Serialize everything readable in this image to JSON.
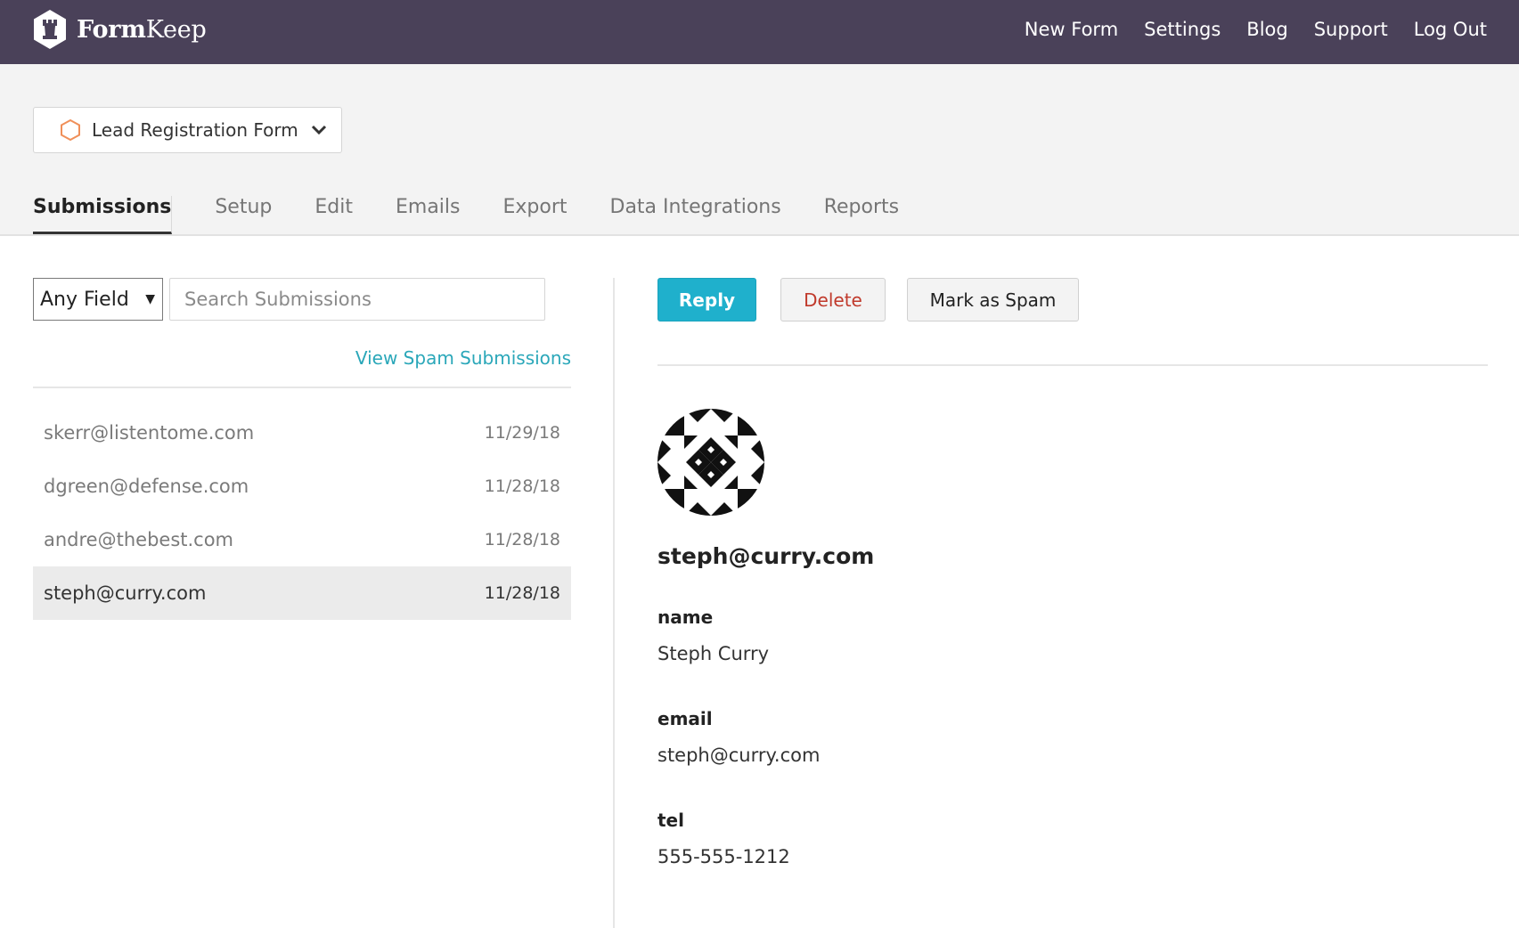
{
  "app": {
    "brand_bold": "Form",
    "brand_light": "Keep"
  },
  "topnav": [
    {
      "label": "New Form"
    },
    {
      "label": "Settings"
    },
    {
      "label": "Blog"
    },
    {
      "label": "Support"
    },
    {
      "label": "Log Out"
    }
  ],
  "form_selector": {
    "label": "Lead Registration Form"
  },
  "tabs": [
    {
      "label": "Submissions",
      "active": true
    },
    {
      "label": "Setup"
    },
    {
      "label": "Edit"
    },
    {
      "label": "Emails"
    },
    {
      "label": "Export"
    },
    {
      "label": "Data Integrations"
    },
    {
      "label": "Reports"
    }
  ],
  "filter": {
    "field_selected": "Any Field",
    "search_placeholder": "Search Submissions",
    "search_value": "",
    "spam_link": "View Spam Submissions"
  },
  "submissions": [
    {
      "email": "skerr@listentome.com",
      "date": "11/29/18"
    },
    {
      "email": "dgreen@defense.com",
      "date": "11/28/18"
    },
    {
      "email": "andre@thebest.com",
      "date": "11/28/18"
    },
    {
      "email": "steph@curry.com",
      "date": "11/28/18",
      "selected": true
    }
  ],
  "detail": {
    "actions": {
      "reply": "Reply",
      "delete": "Delete",
      "spam": "Mark as Spam"
    },
    "from": "steph@curry.com",
    "fields": [
      {
        "label": "name",
        "value": "Steph Curry"
      },
      {
        "label": "email",
        "value": "steph@curry.com"
      },
      {
        "label": "tel",
        "value": "555-555-1212"
      }
    ]
  },
  "colors": {
    "topbar": "#4a4159",
    "accent": "#1fb0cc",
    "link": "#2aa7b9",
    "danger": "#c0392b",
    "form_icon": "#f0905a"
  },
  "icons": {
    "logo": "rook-shield-logo-icon",
    "form": "hexagon-icon",
    "dropdown": "chevron-down-icon",
    "avatar": "identicon-avatar"
  }
}
